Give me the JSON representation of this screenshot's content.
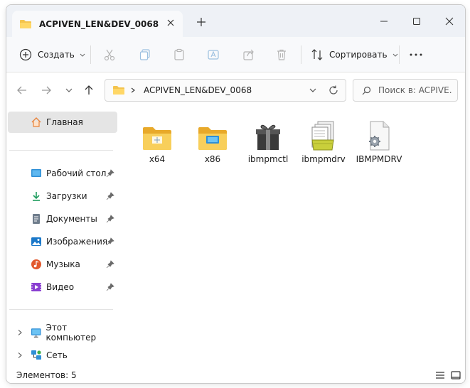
{
  "window": {
    "title": "ACPIVEN_LEN&DEV_0068"
  },
  "controls": {
    "new_tab": "+",
    "minimize": "minimize",
    "maximize": "maximize",
    "close": "close"
  },
  "toolbar": {
    "create_label": "Создать",
    "sort_label": "Сортировать",
    "more_label": "···"
  },
  "address": {
    "path": "ACPIVEN_LEN&DEV_0068",
    "search_placeholder": "Поиск в: ACPIVE..."
  },
  "sidebar": {
    "home": "Главная",
    "items": [
      {
        "label": "Рабочий стол",
        "icon": "desktop-icon"
      },
      {
        "label": "Загрузки",
        "icon": "download-icon"
      },
      {
        "label": "Документы",
        "icon": "document-icon"
      },
      {
        "label": "Изображения",
        "icon": "image-icon"
      },
      {
        "label": "Музыка",
        "icon": "music-icon"
      },
      {
        "label": "Видео",
        "icon": "video-icon"
      }
    ],
    "this_pc": "Этот компьютер",
    "network": "Сеть"
  },
  "files": [
    {
      "name": "x64",
      "type": "folder"
    },
    {
      "name": "x86",
      "type": "folder"
    },
    {
      "name": "ibmpmctl",
      "type": "installer"
    },
    {
      "name": "ibmpmdrv",
      "type": "setup-info"
    },
    {
      "name": "IBMPMDRV",
      "type": "system-file"
    }
  ],
  "status": {
    "items_text": "Элементов: 5"
  },
  "colors": {
    "folder": "#f4c44e",
    "folder_dark": "#e8a92a",
    "accent": "#0067c0",
    "selected": "#e5e5e5"
  }
}
